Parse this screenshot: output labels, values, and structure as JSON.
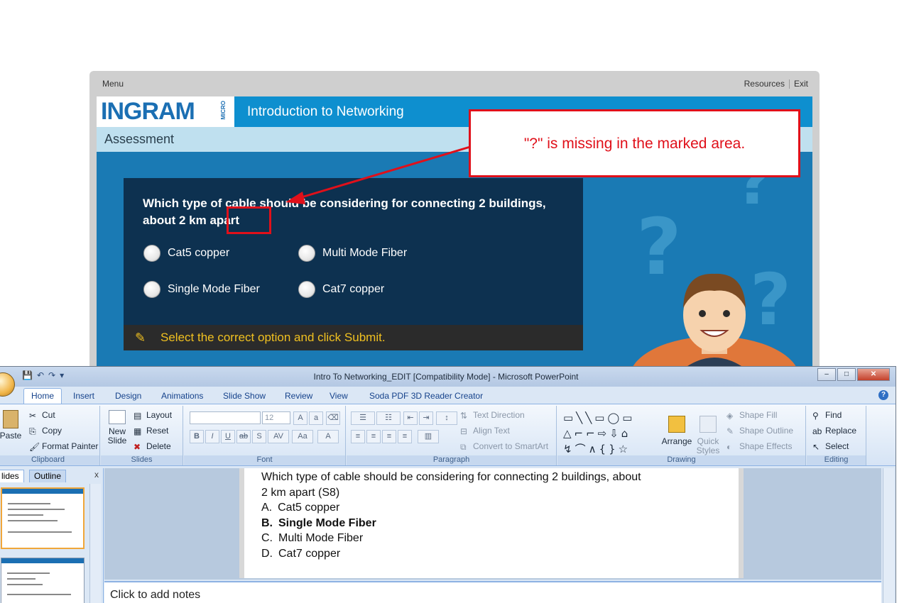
{
  "player": {
    "menu": "Menu",
    "resources": "Resources",
    "exit": "Exit",
    "logo": "INGRAM",
    "logo_sub": "MICRO",
    "course_title": "Introduction to Networking",
    "section_title": "Assessment",
    "question_line1": "Which type of cable should be considering for connecting 2 buildings,",
    "question_line2": "about 2 km apart",
    "options": [
      "Cat5 copper",
      "Multi Mode Fiber",
      "Single Mode Fiber",
      "Cat7 copper"
    ],
    "instruction": "Select the correct option and click Submit."
  },
  "annotation": {
    "callout": "\"?\" is missing in the marked area."
  },
  "ppt": {
    "window_title": "Intro To Networking_EDIT [Compatibility Mode] - Microsoft PowerPoint",
    "tabs": [
      "Home",
      "Insert",
      "Design",
      "Animations",
      "Slide Show",
      "Review",
      "View",
      "Soda PDF 3D Reader Creator"
    ],
    "clipboard": {
      "paste": "Paste",
      "cut": "Cut",
      "copy": "Copy",
      "format_painter": "Format Painter",
      "label": "Clipboard"
    },
    "slides_group": {
      "new_slide": "New",
      "new_slide2": "Slide",
      "layout": "Layout",
      "reset": "Reset",
      "delete": "Delete",
      "label": "Slides"
    },
    "font_group": {
      "size": "12",
      "label": "Font"
    },
    "paragraph_group": {
      "text_direction": "Text Direction",
      "align_text": "Align Text",
      "convert": "Convert to SmartArt",
      "label": "Paragraph"
    },
    "drawing_group": {
      "arrange": "Arrange",
      "quick": "Quick",
      "styles": "Styles",
      "shape_fill": "Shape Fill",
      "shape_outline": "Shape Outline",
      "shape_effects": "Shape Effects",
      "label": "Drawing"
    },
    "editing_group": {
      "find": "Find",
      "replace": "Replace",
      "select": "Select",
      "label": "Editing"
    },
    "panel_tabs": {
      "slides": "lides",
      "outline": "Outline",
      "close": "x"
    },
    "slide_content": {
      "line1": "Which type of cable should be considering for connecting 2 buildings, about",
      "line2": "2 km apart (S8)",
      "answers": [
        {
          "letter": "A.",
          "text": "Cat5 copper"
        },
        {
          "letter": "B.",
          "text": "Single Mode Fiber"
        },
        {
          "letter": "C.",
          "text": "Multi Mode Fiber"
        },
        {
          "letter": "D.",
          "text": "Cat7 copper"
        }
      ]
    },
    "notes_placeholder": "Click to add notes"
  }
}
